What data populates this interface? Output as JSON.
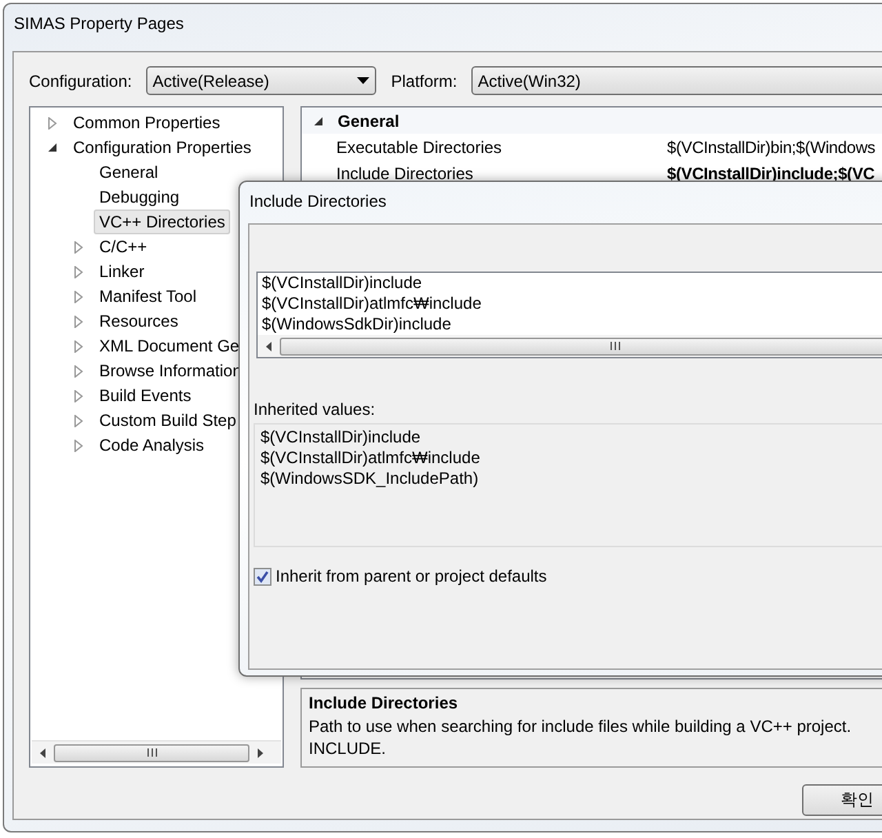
{
  "window": {
    "title": "SIMAS Property Pages"
  },
  "configuration": {
    "label": "Configuration:",
    "value": "Active(Release)"
  },
  "platform": {
    "label": "Platform:",
    "value": "Active(Win32)"
  },
  "tree": [
    {
      "label": "Common Properties",
      "kind": "group",
      "expanded": false,
      "selected": false
    },
    {
      "label": "Configuration Properties",
      "kind": "group",
      "expanded": true,
      "selected": false,
      "children": [
        {
          "label": "General",
          "kind": "page",
          "selected": false
        },
        {
          "label": "Debugging",
          "kind": "page",
          "selected": false
        },
        {
          "label": "VC++ Directories",
          "kind": "page",
          "selected": true
        },
        {
          "label": "C/C++",
          "kind": "group",
          "expanded": false,
          "selected": false
        },
        {
          "label": "Linker",
          "kind": "group",
          "expanded": false,
          "selected": false
        },
        {
          "label": "Manifest Tool",
          "kind": "group",
          "expanded": false,
          "selected": false
        },
        {
          "label": "Resources",
          "kind": "group",
          "expanded": false,
          "selected": false
        },
        {
          "label": "XML Document Ge",
          "kind": "group",
          "expanded": false,
          "selected": false
        },
        {
          "label": "Browse Information",
          "kind": "group",
          "expanded": false,
          "selected": false
        },
        {
          "label": "Build Events",
          "kind": "group",
          "expanded": false,
          "selected": false
        },
        {
          "label": "Custom Build Step",
          "kind": "group",
          "expanded": false,
          "selected": false
        },
        {
          "label": "Code Analysis",
          "kind": "group",
          "expanded": false,
          "selected": false
        }
      ]
    }
  ],
  "grid": {
    "section": "General",
    "expanded": true,
    "rows": [
      {
        "name": "Executable Directories",
        "value": "$(VCInstallDir)bin;$(Windows",
        "bold": false
      },
      {
        "name": "Include Directories",
        "value": "$(VCInstallDir)include;$(VC",
        "bold": true
      }
    ]
  },
  "description": {
    "title": "Include Directories",
    "lines": [
      "Path to use when searching for include files while building a VC++ project.",
      "INCLUDE."
    ]
  },
  "dialog": {
    "title": "Include Directories",
    "edit_lines": [
      "$(VCInstallDir)include",
      "$(VCInstallDir)atlmfc₩include",
      "$(WindowsSdkDir)include"
    ],
    "inherited_label": "Inherited values:",
    "inherited_lines": [
      "$(VCInstallDir)include",
      "$(VCInstallDir)atlmfc₩include",
      "$(WindowsSDK_IncludePath)"
    ],
    "inherit_checkbox": {
      "label": "Inherit from parent or project defaults",
      "checked": true
    }
  },
  "ok_button": "확인"
}
